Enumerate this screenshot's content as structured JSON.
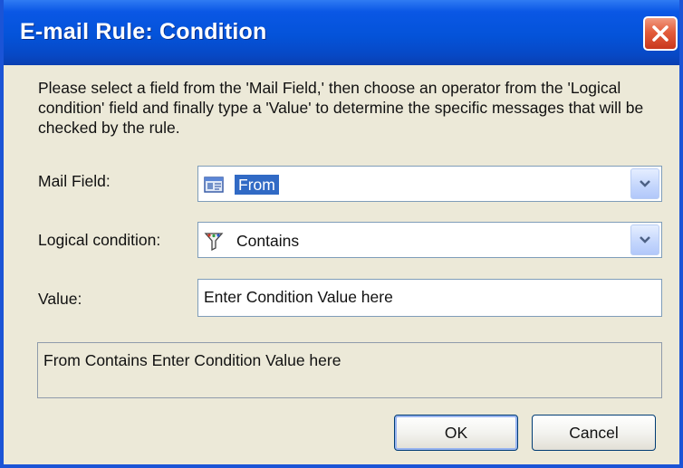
{
  "window": {
    "title": "E-mail Rule: Condition"
  },
  "instructions": "Please select a field from the 'Mail Field,' then choose an operator from the 'Logical condition' field and finally type a 'Value' to determine the specific messages that will be checked by the rule.",
  "mail_field": {
    "label": "Mail Field:",
    "selected": "From",
    "icon": "address-card-icon"
  },
  "logical_condition": {
    "label": "Logical condition:",
    "selected": "Contains",
    "icon": "funnel-filter-icon"
  },
  "value_field": {
    "label": "Value:",
    "value": "Enter Condition Value here"
  },
  "summary": "From Contains Enter Condition Value here",
  "buttons": {
    "ok": "OK",
    "cancel": "Cancel"
  },
  "colors": {
    "titlebar": "#0453d9",
    "dialog_background": "#ece9d8",
    "selection": "#316ac5",
    "close_button": "#e35d3c"
  }
}
